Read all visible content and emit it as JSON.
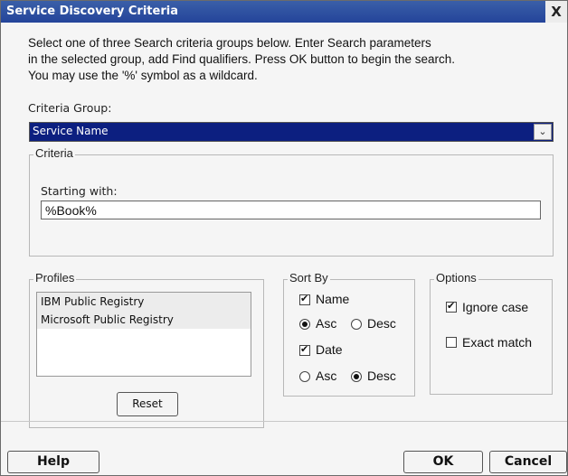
{
  "window": {
    "title": "Service Discovery Criteria",
    "close_glyph": "X"
  },
  "instructions": [
    "Select one of three Search criteria groups below. Enter Search parameters",
    "in the selected group, add Find qualifiers. Press OK button to begin the search.",
    "You may use the '%' symbol as a wildcard."
  ],
  "criteria_group": {
    "label": "Criteria Group:",
    "selected": "Service Name"
  },
  "criteria": {
    "legend": "Criteria",
    "starting_with_label": "Starting with:",
    "starting_with_value": "%Book%"
  },
  "profiles": {
    "legend": "Profiles",
    "items": [
      "IBM Public Registry",
      "Microsoft Public Registry"
    ],
    "reset_label": "Reset"
  },
  "sort_by": {
    "legend": "Sort By",
    "name_label": "Name",
    "name_checked": true,
    "name_order": "Asc",
    "date_label": "Date",
    "date_checked": true,
    "date_order": "Desc",
    "asc_label": "Asc",
    "desc_label": "Desc"
  },
  "options": {
    "legend": "Options",
    "ignore_case_label": "Ignore case",
    "ignore_case_checked": true,
    "exact_match_label": "Exact match",
    "exact_match_checked": false
  },
  "footer": {
    "help_label": "Help",
    "ok_label": "OK",
    "cancel_label": "Cancel"
  }
}
